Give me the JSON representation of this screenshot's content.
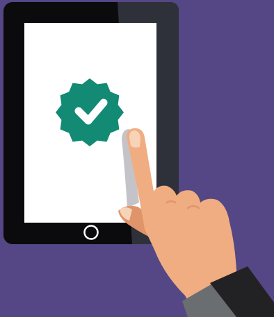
{
  "scene": {
    "subject": "hand-tapping-tablet",
    "screen_icon": "verified-check-badge-icon",
    "colors": {
      "background": "#554785",
      "tablet_body": "#0b0b0d",
      "tablet_shine": "#2e3139",
      "screen": "#ffffff",
      "badge": "#138a73",
      "check": "#ffffff",
      "skin": "#f0ad82",
      "skin_shadow": "#df946a",
      "nail": "#f7d3b8",
      "cuff": "#6b6e70",
      "sleeve": "#222224",
      "finger_shadow": "#c4c4c8"
    }
  }
}
